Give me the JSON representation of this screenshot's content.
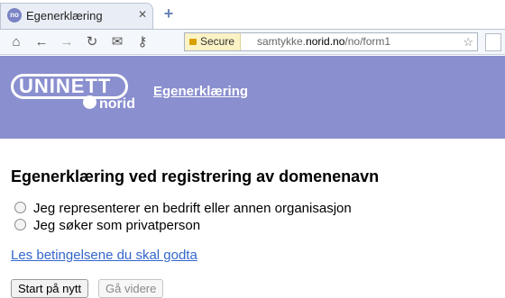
{
  "browser": {
    "tab": {
      "favicon_text": "no",
      "title": "Egenerklæring",
      "close_glyph": "✕"
    },
    "new_tab_glyph": "+",
    "omnibox": {
      "secure_label": "Secure",
      "url_prefix": "samtykke.",
      "url_host": "norid.no",
      "url_path": "/no/form1"
    }
  },
  "banner": {
    "logo_text": "UNINETT",
    "logo_sub": "norid",
    "link_text": "Egenerklæring",
    "color": "#8a8fcf"
  },
  "main": {
    "heading": "Egenerklæring ved registrering av domenenavn",
    "options": [
      {
        "label": "Jeg representerer en bedrift eller annen organisasjon"
      },
      {
        "label": "Jeg søker som privatperson"
      }
    ],
    "terms_link": "Les betingelsene du skal godta",
    "buttons": {
      "restart": "Start på nytt",
      "next": "Gå videre"
    }
  }
}
